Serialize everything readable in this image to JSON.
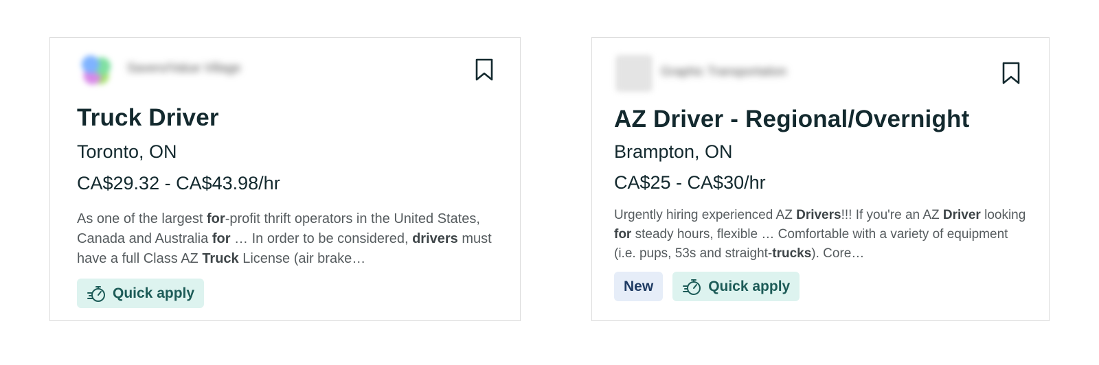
{
  "cards": [
    {
      "company": "Savero/Value Village",
      "title": "Truck Driver",
      "location": "Toronto, ON",
      "pay": "CA$29.32 - CA$43.98/hr",
      "snippet": [
        {
          "t": "As one of the largest ",
          "b": false
        },
        {
          "t": "for",
          "b": true
        },
        {
          "t": "-profit thrift operators in the United States, Canada and Australia ",
          "b": false
        },
        {
          "t": "for",
          "b": true
        },
        {
          "t": " … In order to be considered, ",
          "b": false
        },
        {
          "t": "drivers",
          "b": true
        },
        {
          "t": " must have a full Class AZ ",
          "b": false
        },
        {
          "t": "Truck",
          "b": true
        },
        {
          "t": " License (air brake…",
          "b": false
        }
      ],
      "tags": [
        {
          "type": "quick",
          "label": "Quick apply"
        }
      ]
    },
    {
      "company": "Graphic Transportation",
      "title": "AZ Driver - Regional/Overnight",
      "location": "Brampton, ON",
      "pay": "CA$25 - CA$30/hr",
      "snippet": [
        {
          "t": "Urgently hiring experienced AZ ",
          "b": false
        },
        {
          "t": "Drivers",
          "b": true
        },
        {
          "t": "!!! If you're an AZ ",
          "b": false
        },
        {
          "t": "Driver",
          "b": true
        },
        {
          "t": " looking ",
          "b": false
        },
        {
          "t": "for",
          "b": true
        },
        {
          "t": " steady hours, flexible … Comfortable with a variety of equipment (i.e. pups, 53s and straight-",
          "b": false
        },
        {
          "t": "trucks",
          "b": true
        },
        {
          "t": "). Core…",
          "b": false
        }
      ],
      "tags": [
        {
          "type": "new",
          "label": "New"
        },
        {
          "type": "quick",
          "label": "Quick apply"
        }
      ]
    }
  ],
  "icons": {
    "bookmark": "bookmark-icon",
    "quick_apply": "stopwatch-icon"
  },
  "colors": {
    "title": "#13292e",
    "quick_bg": "#ddf3ef",
    "quick_text": "#1c5b57",
    "new_bg": "#e6edf8",
    "new_text": "#1f3b63"
  }
}
